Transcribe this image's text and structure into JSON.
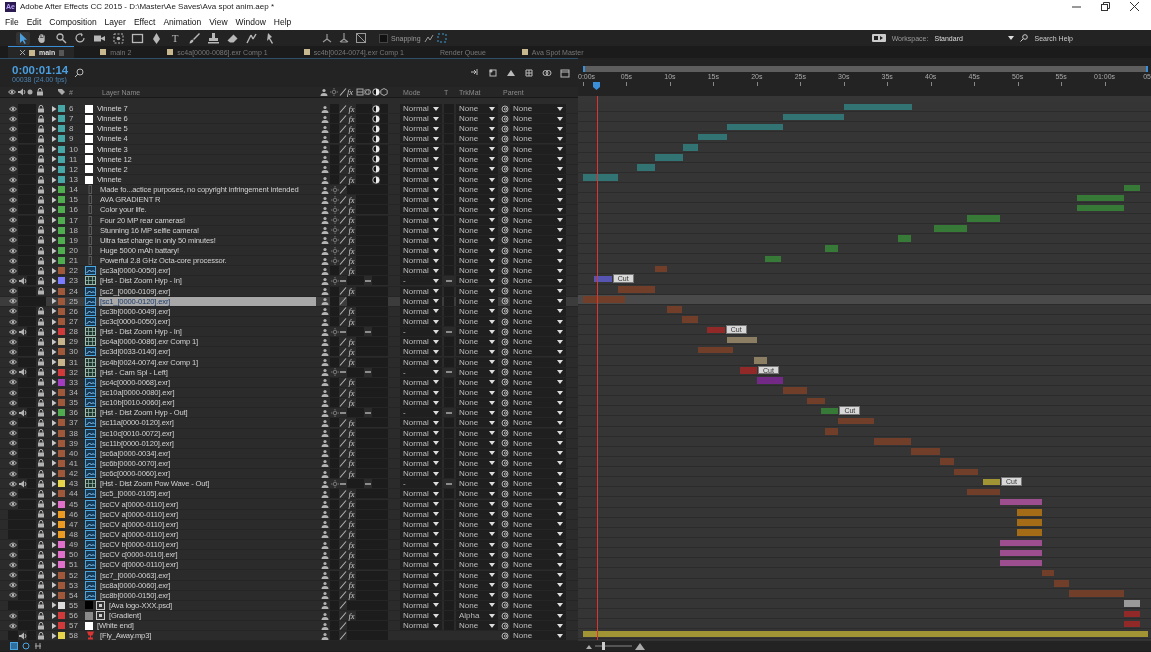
{
  "titlebar": {
    "logo": "Ae",
    "title": "Adobe After Effects CC 2015 - D:\\Master\\Ae Saves\\Ava spot anim.aep *"
  },
  "menu": [
    "File",
    "Edit",
    "Composition",
    "Layer",
    "Effect",
    "Animation",
    "View",
    "Window",
    "Help"
  ],
  "toolbar": {
    "tools": [
      {
        "kind": "selection",
        "selected": true
      },
      {
        "kind": "hand",
        "selected": false
      },
      {
        "kind": "zoom",
        "selected": false
      },
      {
        "kind": "rotate",
        "selected": false
      },
      {
        "kind": "camera",
        "selected": false
      },
      {
        "kind": "pan-behind",
        "selected": false
      },
      {
        "kind": "rectangle",
        "selected": false
      },
      {
        "kind": "pen",
        "selected": false
      },
      {
        "kind": "type",
        "label": "T",
        "selected": false
      },
      {
        "kind": "brush",
        "selected": false
      },
      {
        "kind": "stamp",
        "selected": false
      },
      {
        "kind": "eraser",
        "selected": false
      },
      {
        "kind": "roto",
        "selected": false
      },
      {
        "kind": "puppet",
        "selected": false
      }
    ],
    "axis_modes": [
      {
        "kind": "local"
      },
      {
        "kind": "world"
      },
      {
        "kind": "view"
      }
    ],
    "snapping": {
      "label": "Snapping",
      "checked": false
    },
    "workspace_label": "Workspace:",
    "workspace": "Standard",
    "search_placeholder": "Search Help"
  },
  "tabs": [
    {
      "label": "main",
      "kind": "composition",
      "selected": true
    },
    {
      "label": "main 2",
      "kind": "composition",
      "selected": false
    },
    {
      "label": "sc4a[0000-0086].exr Comp 1",
      "kind": "composition",
      "selected": false
    },
    {
      "label": "sc4b[0024-0074].exr Comp 1",
      "kind": "composition",
      "selected": false
    },
    {
      "label": "Render Queue",
      "kind": "queue",
      "selected": false
    },
    {
      "label": "Ava Spot Master",
      "kind": "composition",
      "selected": false
    }
  ],
  "timecode": "0:00:01:14",
  "frame_info": "00038 (24.00 fps)",
  "columns": {
    "number": "#",
    "name": "Layer Name",
    "fx": "fx",
    "mode": "Mode",
    "t": "T",
    "trkmat": "TrkMat",
    "parent": "Parent"
  },
  "layers": [
    {
      "num": "6",
      "name": "Vinnete 7",
      "color": "#47a6a6",
      "kind": "solid",
      "visible": true,
      "audio": false,
      "locked": true,
      "fx": "fx",
      "adjustment": true,
      "collapse": false,
      "selected": false,
      "mode": "Normal",
      "trkmat": "None",
      "parent": "None"
    },
    {
      "num": "7",
      "name": "Vinnete 6",
      "color": "#47a6a6",
      "kind": "solid",
      "visible": true,
      "audio": false,
      "locked": true,
      "fx": "fx",
      "adjustment": true,
      "collapse": false,
      "selected": false,
      "mode": "Normal",
      "trkmat": "None",
      "parent": "None"
    },
    {
      "num": "8",
      "name": "Vinnete 5",
      "color": "#47a6a6",
      "kind": "solid",
      "visible": true,
      "audio": false,
      "locked": true,
      "fx": "fx",
      "adjustment": true,
      "collapse": false,
      "selected": false,
      "mode": "Normal",
      "trkmat": "None",
      "parent": "None"
    },
    {
      "num": "9",
      "name": "Vinnete 4",
      "color": "#47a6a6",
      "kind": "solid",
      "visible": true,
      "audio": false,
      "locked": true,
      "fx": "fx",
      "adjustment": true,
      "collapse": false,
      "selected": false,
      "mode": "Normal",
      "trkmat": "None",
      "parent": "None"
    },
    {
      "num": "10",
      "name": "Vinnete 3",
      "color": "#47a6a6",
      "kind": "solid",
      "visible": true,
      "audio": false,
      "locked": true,
      "fx": "fx",
      "adjustment": true,
      "collapse": false,
      "selected": false,
      "mode": "Normal",
      "trkmat": "None",
      "parent": "None"
    },
    {
      "num": "11",
      "name": "Vinnete 12",
      "color": "#47a6a6",
      "kind": "solid",
      "visible": true,
      "audio": false,
      "locked": true,
      "fx": "fx",
      "adjustment": true,
      "collapse": false,
      "selected": false,
      "mode": "Normal",
      "trkmat": "None",
      "parent": "None"
    },
    {
      "num": "12",
      "name": "Vinnete 2",
      "color": "#47a6a6",
      "kind": "solid",
      "visible": true,
      "audio": false,
      "locked": true,
      "fx": "fx",
      "adjustment": true,
      "collapse": false,
      "selected": false,
      "mode": "Normal",
      "trkmat": "None",
      "parent": "None"
    },
    {
      "num": "13",
      "name": "Vinnete",
      "color": "#47a6a6",
      "kind": "solid",
      "visible": true,
      "audio": false,
      "locked": true,
      "fx": "fx",
      "adjustment": true,
      "collapse": false,
      "selected": false,
      "mode": "Normal",
      "trkmat": "None",
      "parent": "None"
    },
    {
      "num": "14",
      "name": "Made fo...actice purposes, no copyright infringement intended",
      "color": "#4fad4f",
      "kind": "text",
      "visible": true,
      "audio": false,
      "locked": true,
      "adjustment": false,
      "collapse": false,
      "selected": false,
      "mode": "Normal",
      "trkmat": "None",
      "parent": "None"
    },
    {
      "num": "15",
      "name": "AVA GRADIENT R",
      "color": "#4fad4f",
      "kind": "text",
      "visible": true,
      "audio": false,
      "locked": true,
      "fx": "fx",
      "adjustment": false,
      "collapse": false,
      "selected": false,
      "mode": "Normal",
      "trkmat": "None",
      "parent": "None"
    },
    {
      "num": "16",
      "name": "Color your life.",
      "color": "#4fad4f",
      "kind": "text",
      "visible": true,
      "audio": false,
      "locked": true,
      "fx": "fx",
      "adjustment": false,
      "collapse": false,
      "selected": false,
      "mode": "Normal",
      "trkmat": "None",
      "parent": "None"
    },
    {
      "num": "17",
      "name": "Four 20 MP rear cameras!",
      "color": "#4fad4f",
      "kind": "text",
      "visible": true,
      "audio": false,
      "locked": true,
      "fx": "fx",
      "adjustment": false,
      "collapse": false,
      "selected": false,
      "mode": "Normal",
      "trkmat": "None",
      "parent": "None"
    },
    {
      "num": "18",
      "name": "Stunning 16 MP selfie camera!",
      "color": "#4fad4f",
      "kind": "text",
      "visible": true,
      "audio": false,
      "locked": true,
      "fx": "fx",
      "adjustment": false,
      "collapse": false,
      "selected": false,
      "mode": "Normal",
      "trkmat": "None",
      "parent": "None"
    },
    {
      "num": "19",
      "name": "Ultra fast charge in only 50 minutes!",
      "color": "#4fad4f",
      "kind": "text",
      "visible": true,
      "audio": false,
      "locked": true,
      "fx": "fx",
      "adjustment": false,
      "collapse": false,
      "selected": false,
      "mode": "Normal",
      "trkmat": "None",
      "parent": "None"
    },
    {
      "num": "20",
      "name": "Huge 5000 mAh battary!",
      "color": "#4fad4f",
      "kind": "text",
      "visible": true,
      "audio": false,
      "locked": true,
      "fx": "fx",
      "adjustment": false,
      "collapse": false,
      "selected": false,
      "mode": "Normal",
      "trkmat": "None",
      "parent": "None"
    },
    {
      "num": "21",
      "name": "Powerful 2.8 GHz Octa-core processor.",
      "color": "#4fad4f",
      "kind": "text",
      "visible": true,
      "audio": false,
      "locked": true,
      "fx": "fx",
      "adjustment": false,
      "collapse": false,
      "selected": false,
      "mode": "Normal",
      "trkmat": "None",
      "parent": "None"
    },
    {
      "num": "22",
      "name": "[sc3a[0000-0050].exr]",
      "color": "#a0583a",
      "kind": "footage",
      "visible": true,
      "audio": false,
      "locked": true,
      "fx": "fx",
      "adjustment": false,
      "collapse": false,
      "selected": false,
      "mode": "Normal",
      "trkmat": "None",
      "parent": "None"
    },
    {
      "num": "23",
      "name": "[Hst - Dist Zoom Hyp - In]",
      "color": "#7b7bff",
      "kind": "composition",
      "visible": true,
      "audio": true,
      "locked": true,
      "adjustment": false,
      "collapse": true,
      "selected": false,
      "mode": "-",
      "trkmat": "None",
      "parent": "None",
      "marker": "Cut"
    },
    {
      "num": "24",
      "name": "[sc2_[0000-0109].exr]",
      "color": "#a0583a",
      "kind": "footage",
      "visible": true,
      "audio": false,
      "locked": true,
      "fx": "fx",
      "adjustment": false,
      "collapse": false,
      "selected": false,
      "mode": "Normal",
      "trkmat": "None",
      "parent": "None"
    },
    {
      "num": "25",
      "name": "[sc1_[0000-0120].exr]",
      "color": "#a0583a",
      "kind": "footage",
      "visible": true,
      "audio": false,
      "locked": false,
      "adjustment": false,
      "collapse": false,
      "selected": true,
      "mode": "Normal",
      "trkmat": "None",
      "parent": "None"
    },
    {
      "num": "26",
      "name": "[sc3b[0000-0049].exr]",
      "color": "#a0583a",
      "kind": "footage",
      "visible": true,
      "audio": false,
      "locked": true,
      "fx": "fx",
      "adjustment": false,
      "collapse": false,
      "selected": false,
      "mode": "Normal",
      "trkmat": "None",
      "parent": "None"
    },
    {
      "num": "27",
      "name": "[sc3c[0000-0050].exr]",
      "color": "#a0583a",
      "kind": "footage",
      "visible": true,
      "audio": false,
      "locked": true,
      "fx": "fx",
      "adjustment": false,
      "collapse": false,
      "selected": false,
      "mode": "Normal",
      "trkmat": "None",
      "parent": "None"
    },
    {
      "num": "28",
      "name": "[Hst - Dist Zoom Hyp - In]",
      "color": "#d03a3a",
      "kind": "composition",
      "visible": true,
      "audio": true,
      "locked": true,
      "adjustment": false,
      "collapse": true,
      "selected": false,
      "mode": "-",
      "trkmat": "None",
      "parent": "None",
      "marker": "Cut"
    },
    {
      "num": "29",
      "name": "[sc4a[0000-0086].exr Comp 1]",
      "color": "#c8b48c",
      "kind": "composition",
      "visible": true,
      "audio": false,
      "locked": true,
      "fx": "fx",
      "adjustment": false,
      "collapse": false,
      "selected": false,
      "mode": "Normal",
      "trkmat": "None",
      "parent": "None"
    },
    {
      "num": "30",
      "name": "[sc3d[0033-0140].exr]",
      "color": "#a0583a",
      "kind": "footage",
      "visible": true,
      "audio": false,
      "locked": true,
      "fx": "fx",
      "adjustment": false,
      "collapse": false,
      "selected": false,
      "mode": "Normal",
      "trkmat": "None",
      "parent": "None"
    },
    {
      "num": "31",
      "name": "[sc4b[0024-0074].exr Comp 1]",
      "color": "#c8b48c",
      "kind": "composition",
      "visible": true,
      "audio": false,
      "locked": true,
      "fx": "fx",
      "adjustment": false,
      "collapse": false,
      "selected": false,
      "mode": "Normal",
      "trkmat": "None",
      "parent": "None"
    },
    {
      "num": "32",
      "name": "[Hst - Cam Spl - Left]",
      "color": "#d03a3a",
      "kind": "composition",
      "visible": true,
      "audio": true,
      "locked": true,
      "adjustment": false,
      "collapse": true,
      "selected": false,
      "mode": "-",
      "trkmat": "None",
      "parent": "None",
      "marker": "Cut"
    },
    {
      "num": "33",
      "name": "[sc4c[0000-0068].exr]",
      "color": "#a43cc0",
      "kind": "footage",
      "visible": true,
      "audio": false,
      "locked": true,
      "fx": "fx",
      "adjustment": false,
      "collapse": false,
      "selected": false,
      "mode": "Normal",
      "trkmat": "None",
      "parent": "None"
    },
    {
      "num": "34",
      "name": "[sc10a[0000-0080].exr]",
      "color": "#a0583a",
      "kind": "footage",
      "visible": true,
      "audio": false,
      "locked": true,
      "fx": "fx",
      "adjustment": false,
      "collapse": false,
      "selected": false,
      "mode": "Normal",
      "trkmat": "None",
      "parent": "None"
    },
    {
      "num": "35",
      "name": "[sc10b[0010-0060].exr]",
      "color": "#a0583a",
      "kind": "footage",
      "visible": true,
      "audio": false,
      "locked": true,
      "fx": "fx",
      "adjustment": false,
      "collapse": false,
      "selected": false,
      "mode": "Normal",
      "trkmat": "None",
      "parent": "None"
    },
    {
      "num": "36",
      "name": "[Hst - Dist Zoom Hyp - Out]",
      "color": "#4fad4f",
      "kind": "composition",
      "visible": true,
      "audio": true,
      "locked": true,
      "adjustment": false,
      "collapse": true,
      "selected": false,
      "mode": "-",
      "trkmat": "None",
      "parent": "None",
      "marker": "Cut"
    },
    {
      "num": "37",
      "name": "[sc11a[0000-0120].exr]",
      "color": "#a0583a",
      "kind": "footage",
      "visible": true,
      "audio": false,
      "locked": true,
      "fx": "fx",
      "adjustment": false,
      "collapse": false,
      "selected": false,
      "mode": "Normal",
      "trkmat": "None",
      "parent": "None"
    },
    {
      "num": "38",
      "name": "[sc10c[0010-0072].exr]",
      "color": "#a0583a",
      "kind": "footage",
      "visible": true,
      "audio": false,
      "locked": true,
      "fx": "fx",
      "adjustment": false,
      "collapse": false,
      "selected": false,
      "mode": "Normal",
      "trkmat": "None",
      "parent": "None"
    },
    {
      "num": "39",
      "name": "[sc11b[0000-0120].exr]",
      "color": "#a0583a",
      "kind": "footage",
      "visible": true,
      "audio": false,
      "locked": true,
      "fx": "fx",
      "adjustment": false,
      "collapse": false,
      "selected": false,
      "mode": "Normal",
      "trkmat": "None",
      "parent": "None"
    },
    {
      "num": "40",
      "name": "[sc6a[0000-0034].exr]",
      "color": "#a0583a",
      "kind": "footage",
      "visible": true,
      "audio": false,
      "locked": true,
      "fx": "fx",
      "adjustment": false,
      "collapse": false,
      "selected": false,
      "mode": "Normal",
      "trkmat": "None",
      "parent": "None"
    },
    {
      "num": "41",
      "name": "[sc6b[0000-0070].exr]",
      "color": "#a0583a",
      "kind": "footage",
      "visible": true,
      "audio": false,
      "locked": true,
      "fx": "fx",
      "adjustment": false,
      "collapse": false,
      "selected": false,
      "mode": "Normal",
      "trkmat": "None",
      "parent": "None"
    },
    {
      "num": "42",
      "name": "[sc6c[0000-0060].exr]",
      "color": "#a0583a",
      "kind": "footage",
      "visible": true,
      "audio": false,
      "locked": true,
      "fx": "fx",
      "adjustment": false,
      "collapse": false,
      "selected": false,
      "mode": "Normal",
      "trkmat": "None",
      "parent": "None"
    },
    {
      "num": "43",
      "name": "[Hst - Dist Zoom Pow Wave - Out]",
      "color": "#e6d44a",
      "kind": "composition",
      "visible": true,
      "audio": true,
      "locked": true,
      "adjustment": false,
      "collapse": true,
      "selected": false,
      "mode": "-",
      "trkmat": "None",
      "parent": "None",
      "marker": "Cut"
    },
    {
      "num": "44",
      "name": "[sc5_[0000-0105].exr]",
      "color": "#a0583a",
      "kind": "footage",
      "visible": true,
      "audio": false,
      "locked": true,
      "fx": "fx",
      "adjustment": false,
      "collapse": false,
      "selected": false,
      "mode": "Normal",
      "trkmat": "None",
      "parent": "None"
    },
    {
      "num": "45",
      "name": "[scCV a[0000-0110].exr]",
      "color": "#e070cc",
      "kind": "footage",
      "visible": true,
      "audio": false,
      "locked": true,
      "fx": "fx",
      "adjustment": false,
      "collapse": false,
      "selected": false,
      "mode": "Normal",
      "trkmat": "None",
      "parent": "None"
    },
    {
      "num": "46",
      "name": "[scCV a[0000-0110].exr]",
      "color": "#eb9a22",
      "kind": "footage",
      "visible": false,
      "audio": false,
      "locked": true,
      "fx": "fx",
      "adjustment": false,
      "collapse": false,
      "selected": false,
      "mode": "Normal",
      "trkmat": "None",
      "parent": "None"
    },
    {
      "num": "47",
      "name": "[scCV a[0000-0110].exr]",
      "color": "#eb9a22",
      "kind": "footage",
      "visible": false,
      "audio": false,
      "locked": true,
      "fx": "fx",
      "adjustment": false,
      "collapse": false,
      "selected": false,
      "mode": "Normal",
      "trkmat": "None",
      "parent": "None"
    },
    {
      "num": "48",
      "name": "[scCV a[0000-0110].exr]",
      "color": "#eb9a22",
      "kind": "footage",
      "visible": false,
      "audio": false,
      "locked": true,
      "fx": "fx",
      "adjustment": false,
      "collapse": false,
      "selected": false,
      "mode": "Normal",
      "trkmat": "None",
      "parent": "None"
    },
    {
      "num": "49",
      "name": "[scCV b[0000-0110].exr]",
      "color": "#e070cc",
      "kind": "footage",
      "visible": true,
      "audio": false,
      "locked": true,
      "fx": "fx",
      "adjustment": false,
      "collapse": false,
      "selected": false,
      "mode": "Normal",
      "trkmat": "None",
      "parent": "None"
    },
    {
      "num": "50",
      "name": "[scCV c[0000-0110].exr]",
      "color": "#e070cc",
      "kind": "footage",
      "visible": true,
      "audio": false,
      "locked": true,
      "fx": "fx",
      "adjustment": false,
      "collapse": false,
      "selected": false,
      "mode": "Normal",
      "trkmat": "None",
      "parent": "None"
    },
    {
      "num": "51",
      "name": "[scCV d[0000-0110].exr]",
      "color": "#e070cc",
      "kind": "footage",
      "visible": true,
      "audio": false,
      "locked": true,
      "fx": "fx",
      "adjustment": false,
      "collapse": false,
      "selected": false,
      "mode": "Normal",
      "trkmat": "None",
      "parent": "None"
    },
    {
      "num": "52",
      "name": "[sc7_[0000-0063].exr]",
      "color": "#a0583a",
      "kind": "footage",
      "visible": true,
      "audio": false,
      "locked": true,
      "fx": "fx",
      "adjustment": false,
      "collapse": false,
      "selected": false,
      "mode": "Normal",
      "trkmat": "None",
      "parent": "None"
    },
    {
      "num": "53",
      "name": "[sc8a[0000-0060].exr]",
      "color": "#a0583a",
      "kind": "footage",
      "visible": true,
      "audio": false,
      "locked": true,
      "fx": "fx",
      "adjustment": false,
      "collapse": false,
      "selected": false,
      "mode": "Normal",
      "trkmat": "None",
      "parent": "None"
    },
    {
      "num": "54",
      "name": "[sc8b[0000-0150].exr]",
      "color": "#a0583a",
      "kind": "footage",
      "visible": true,
      "audio": false,
      "locked": true,
      "fx": "fx",
      "adjustment": false,
      "collapse": false,
      "selected": false,
      "mode": "Normal",
      "trkmat": "None",
      "parent": "None"
    },
    {
      "num": "55",
      "name": "[Ava logo-XXX.psd]",
      "color": "#dcdcdc",
      "kind": "psd",
      "visible": false,
      "audio": false,
      "locked": true,
      "adjustment": false,
      "collapse": false,
      "selected": false,
      "mode": "Normal",
      "trkmat": "None",
      "parent": "None"
    },
    {
      "num": "56",
      "name": "[Gradient]",
      "color": "#d03a3a",
      "kind": "generated",
      "visible": true,
      "audio": false,
      "locked": true,
      "fx": "fx",
      "adjustment": false,
      "collapse": false,
      "selected": false,
      "mode": "Normal",
      "trkmat": "Alpha",
      "parent": "None"
    },
    {
      "num": "57",
      "name": "[White end]",
      "color": "#d03a3a",
      "kind": "solid",
      "visible": true,
      "audio": false,
      "locked": true,
      "adjustment": false,
      "collapse": false,
      "selected": false,
      "mode": "Normal",
      "trkmat": "None",
      "parent": "None"
    },
    {
      "num": "58",
      "name": "[Fly_Away.mp3]",
      "color": "#e6d44a",
      "kind": "audio",
      "visible": false,
      "audio": true,
      "locked": true,
      "adjustment": false,
      "collapse": false,
      "selected": false,
      "parent": "None"
    }
  ],
  "timeline": {
    "ruler": [
      "0:00s",
      "05s",
      "10s",
      "15s",
      "20s",
      "25s",
      "30s",
      "35s",
      "40s",
      "45s",
      "50s",
      "55s",
      "01:00s",
      "05"
    ]
  },
  "zoom": {
    "level": 0.2
  }
}
